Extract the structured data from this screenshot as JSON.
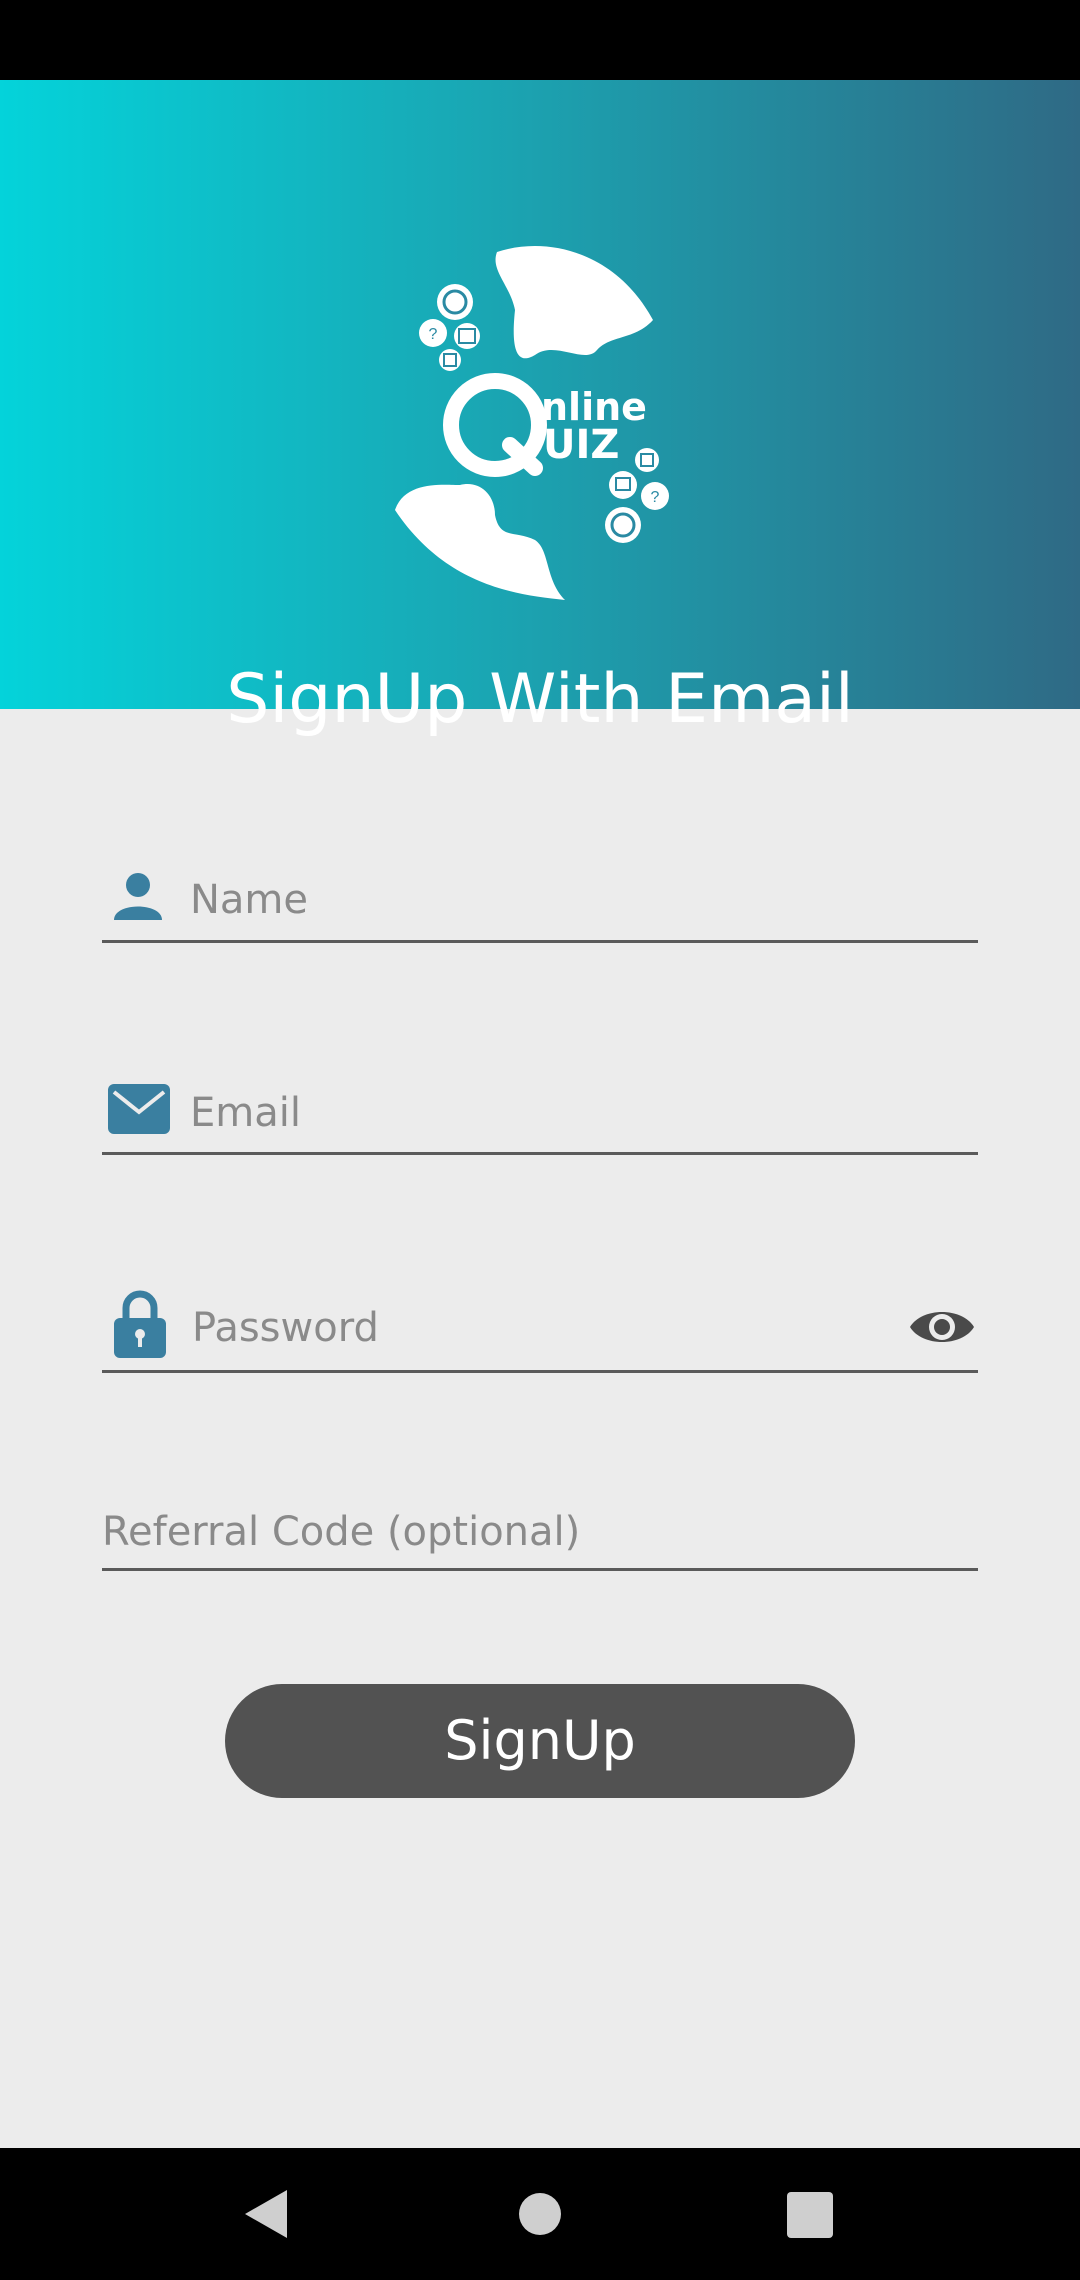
{
  "header": {
    "logo_top": "nline",
    "logo_bottom": "UIZ",
    "logo_letter": "Q",
    "title": "SignUp With Email"
  },
  "form": {
    "name_placeholder": "Name",
    "email_placeholder": "Email",
    "password_placeholder": "Password",
    "referral_placeholder": "Referral Code (optional)",
    "signup_label": "SignUp"
  },
  "icons": {
    "name": "person-icon",
    "email": "mail-icon",
    "password": "lock-icon",
    "toggle_password": "eye-icon"
  },
  "colors": {
    "accent": "#3a7fa0",
    "button": "#525252",
    "header_start": "#04d3da",
    "header_end": "#2f6a85"
  }
}
